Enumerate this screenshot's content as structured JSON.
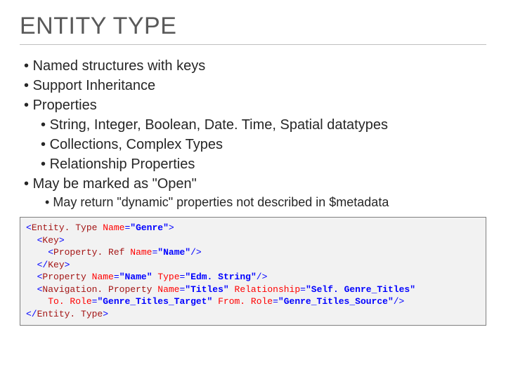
{
  "title": "ENTITY TYPE",
  "bullets": {
    "b1": "Named structures with keys",
    "b2": "Support Inheritance",
    "b3": "Properties",
    "b3a": "String, Integer, Boolean, Date. Time, Spatial datatypes",
    "b3b": "Collections, Complex Types",
    "b3c": "Relationship Properties",
    "b4": "May be marked as \"Open\"",
    "b4a": "May return \"dynamic\" properties not described in $metadata"
  },
  "code": {
    "l1": {
      "elem": "Entity. Type",
      "attr": "Name",
      "val": "\"Genre\""
    },
    "l2": {
      "elem": "Key"
    },
    "l3": {
      "elem": "Property. Ref",
      "attr": "Name",
      "val": "\"Name\""
    },
    "l4": {
      "elem": "Key"
    },
    "l5": {
      "elem": "Property",
      "a1": "Name",
      "v1": "\"Name\"",
      "a2": "Type",
      "v2": "\"Edm. String\""
    },
    "l6": {
      "elem": "Navigation. Property",
      "a1": "Name",
      "v1": "\"Titles\"",
      "a2": "Relationship",
      "v2": "\"Self. Genre_Titles\""
    },
    "l7": {
      "a1": "To. Role",
      "v1": "\"Genre_Titles_Target\"",
      "a2": "From. Role",
      "v2": "\"Genre_Titles_Source\""
    },
    "l8": {
      "elem": "Entity. Type"
    }
  }
}
